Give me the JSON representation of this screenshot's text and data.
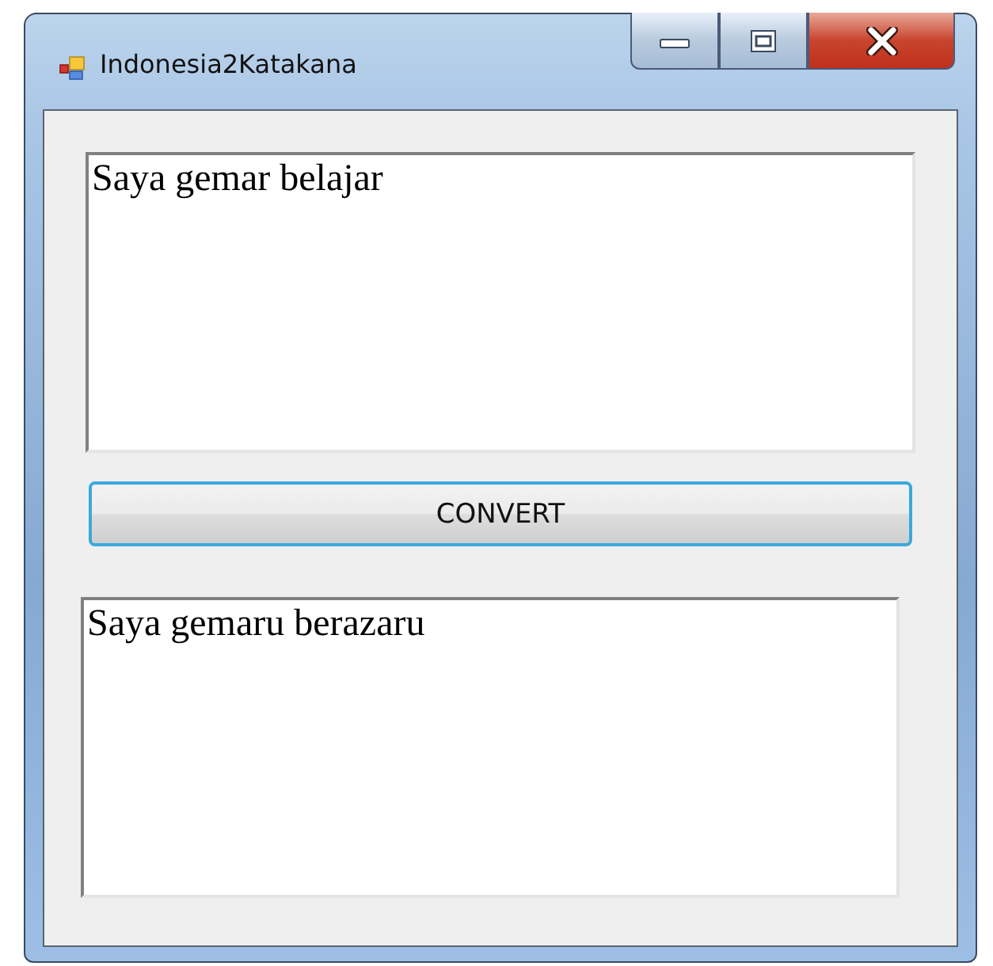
{
  "window": {
    "title": "Indonesia2Katakana"
  },
  "input": {
    "value": "Saya gemar belajar"
  },
  "button": {
    "label": "CONVERT",
    "focused": true
  },
  "output": {
    "value": "Saya gemaru berazaru"
  }
}
